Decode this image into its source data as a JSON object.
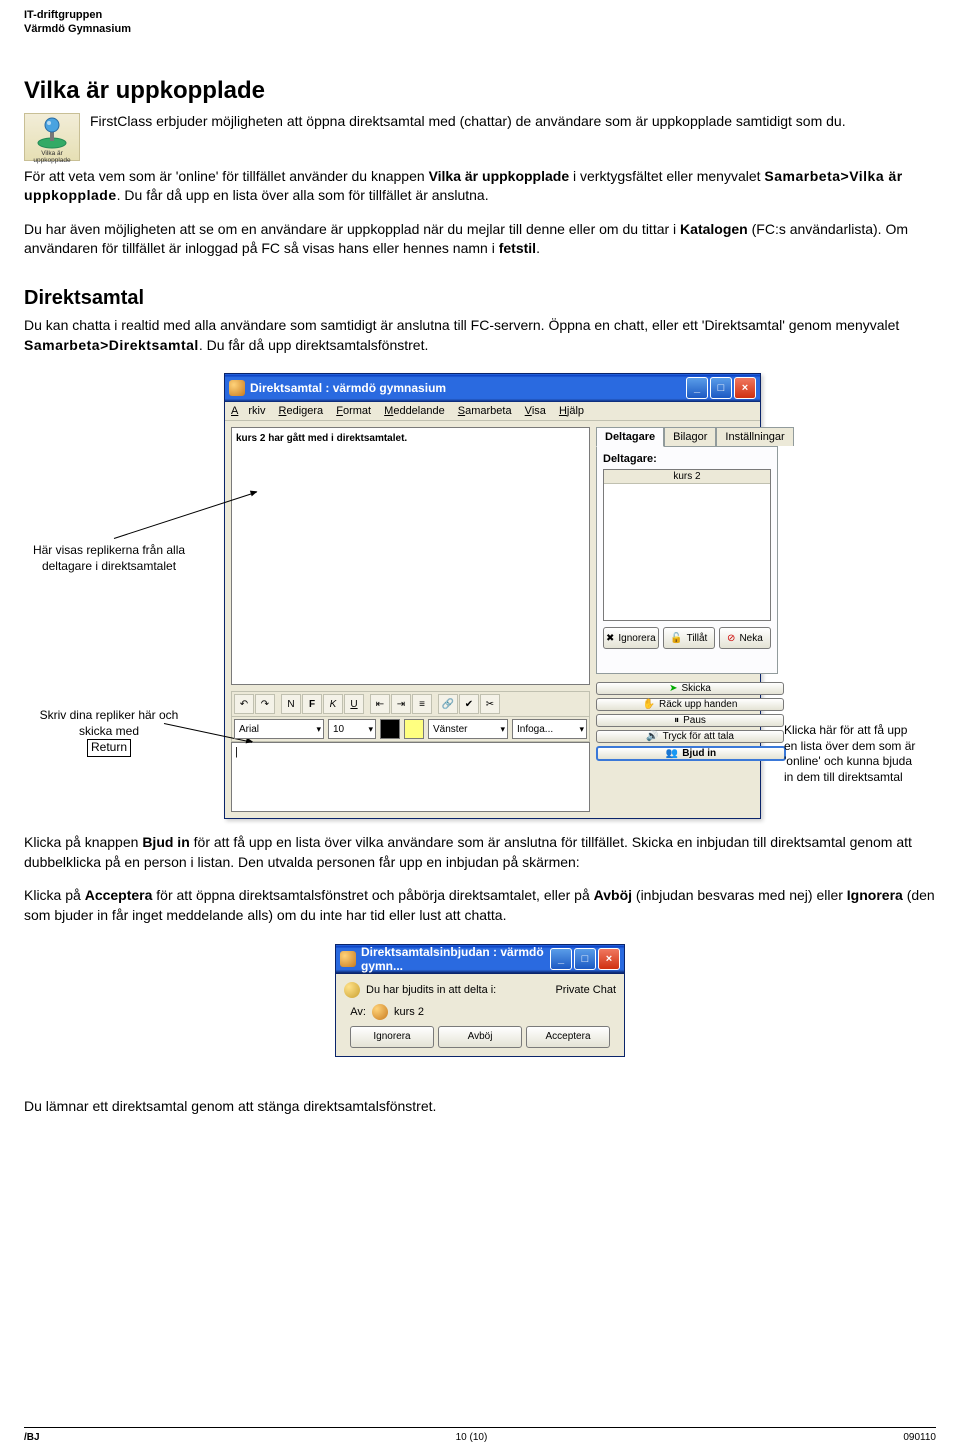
{
  "header": {
    "line1": "IT-driftgruppen",
    "line2": "Värmdö Gymnasium"
  },
  "h1": "Vilka är uppkopplade",
  "thumb_caption": "Vilka är uppkopplade",
  "p1a": "FirstClass erbjuder möjligheten att öppna direktsamtal med (chattar) de användare som är uppkopplade samtidigt som du.",
  "p1b_pre": "För att veta vem som är 'online' för tillfället använder du knappen ",
  "p1b_bold": "Vilka är uppkopplade",
  "p1b_mid": " i verktygsfältet eller menyvalet ",
  "p1b_menu": "Samarbeta>Vilka är uppkopplade",
  "p1b_post": ". Du får då upp en lista över alla som för tillfället är anslutna.",
  "p2_pre": "Du har även möjligheten att se om en användare är uppkopplad när du mejlar till denne eller om du tittar i ",
  "p2_bold": "Katalogen",
  "p2_mid": " (FC:s användarlista). Om användaren för tillfället är inloggad på FC så visas hans eller hennes namn i ",
  "p2_bold2": "fetstil",
  "p2_end": ".",
  "h2": "Direktsamtal",
  "p3_pre": "Du kan chatta i realtid med alla användare som samtidigt är anslutna till FC-servern. Öppna en chatt, eller ett 'Direktsamtal' genom menyvalet ",
  "p3_menu": "Samarbeta>Direktsamtal",
  "p3_post": ". Du får då upp direktsamtalsfönstret.",
  "annot": {
    "left1": "Här visas replikerna från alla deltagare i direktsamtalet",
    "left2_l1": "Skriv dina repliker här och skicka med",
    "left2_ret": "Return",
    "right1": "Klicka här för att få upp en lista över dem som är 'online' och kunna bjuda in dem till direktsamtal"
  },
  "chatwin": {
    "title": "Direktsamtal : värmdö gymnasium",
    "menus": [
      "Arkiv",
      "Redigera",
      "Format",
      "Meddelande",
      "Samarbeta",
      "Visa",
      "Hjälp"
    ],
    "log_line": "kurs 2 har gått med i direktsamtalet.",
    "tabs": [
      "Deltagare",
      "Bilagor",
      "Inställningar"
    ],
    "participants_label": "Deltagare:",
    "plist_header": "kurs 2",
    "btns_mid": {
      "ignore": "Ignorera",
      "allow": "Tillåt",
      "deny": "Neka"
    },
    "right_btns": {
      "send": "Skicka",
      "raise": "Räck upp handen",
      "pause": "Paus",
      "press": "Tryck för att tala",
      "invite": "Bjud in"
    },
    "toolbar2": {
      "font": "Arial",
      "size": "10",
      "align": "Vänster",
      "insert": "Infoga..."
    },
    "cursor": "|"
  },
  "p4_pre": "Klicka på knappen ",
  "p4_bold": "Bjud in",
  "p4_post": " för att få upp en lista över vilka användare som är anslutna för tillfället. Skicka en inbjudan till direktsamtal genom att dubbelklicka på en person i listan. Den utvalda personen får upp en inbjudan på skärmen:",
  "p5_pre": "Klicka på ",
  "p5_b1": "Acceptera",
  "p5_mid1": " för att öppna direktsamtalsfönstret och påbörja direktsamtalet, eller på ",
  "p5_b2": "Avböj",
  "p5_mid2": " (inbjudan besvaras med nej) eller ",
  "p5_b3": "Ignorera",
  "p5_post": " (den som bjuder in får inget meddelande alls) om du inte har tid eller lust att chatta.",
  "invite": {
    "title": "Direktsamtalsinbjudan : värmdö gymn...",
    "line1_pre": "Du har bjudits in att delta i:",
    "line1_val": "Private Chat",
    "from_label": "Av:",
    "from_val": "kurs 2",
    "btns": {
      "ignore": "Ignorera",
      "decline": "Avböj",
      "accept": "Acceptera"
    }
  },
  "p6": "Du lämnar ett direktsamtal genom att stänga direktsamtalsfönstret.",
  "footer": {
    "left": "/BJ",
    "center": "10 (10)",
    "right": "090110"
  }
}
